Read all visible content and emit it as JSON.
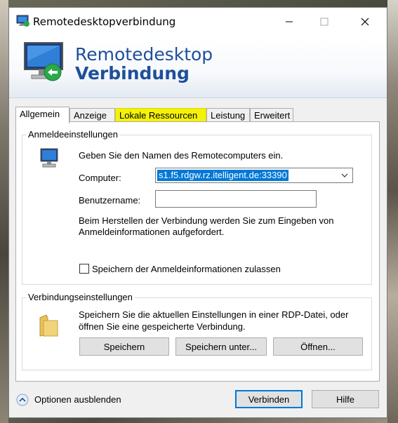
{
  "window": {
    "title": "Remotedesktopverbindung"
  },
  "banner": {
    "line1": "Remotedesktop",
    "line2": "Verbindung"
  },
  "tabs": [
    {
      "label": "Allgemein",
      "active": true
    },
    {
      "label": "Anzeige"
    },
    {
      "label": "Lokale Ressourcen",
      "highlighted": true
    },
    {
      "label": "Leistung"
    },
    {
      "label": "Erweitert"
    }
  ],
  "login": {
    "group_label": "Anmeldeeinstellungen",
    "instruction": "Geben Sie den Namen des Remotecomputers ein.",
    "computer_label": "Computer:",
    "computer_value": "s1.f5.rdgw.rz.itelligent.de:33390",
    "username_label": "Benutzername:",
    "username_value": "",
    "info_line1": "Beim Herstellen der Verbindung werden Sie zum Eingeben von",
    "info_line2": "Anmeldeinformationen aufgefordert.",
    "save_creds_label": "Speichern der Anmeldeinformationen zulassen",
    "save_creds_checked": false
  },
  "connection": {
    "group_label": "Verbindungseinstellungen",
    "text_line1": "Speichern Sie die aktuellen Einstellungen in einer RDP-Datei, oder",
    "text_line2": "öffnen Sie eine gespeicherte Verbindung.",
    "save_button": "Speichern",
    "save_as_button": "Speichern unter...",
    "open_button": "Öffnen..."
  },
  "footer": {
    "options_label": "Optionen ausblenden",
    "connect_button": "Verbinden",
    "help_button": "Hilfe"
  },
  "colors": {
    "accent": "#0078d7",
    "banner_text": "#1e4f9a",
    "highlight": "#f5f20a"
  }
}
